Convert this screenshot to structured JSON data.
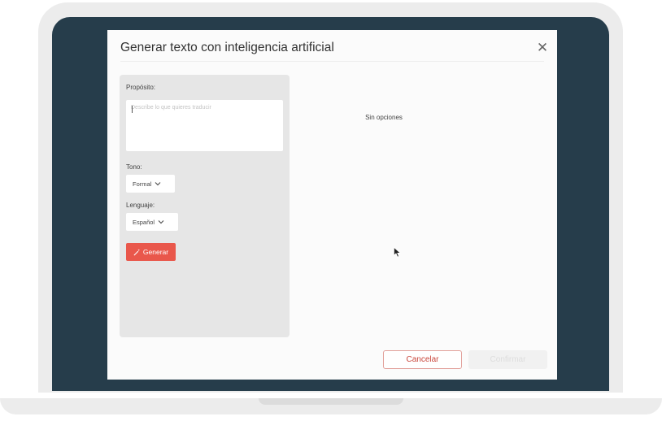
{
  "modal": {
    "title": "Generar texto con inteligencia artificial",
    "close_icon": "close-icon"
  },
  "form": {
    "purpose_label": "Propósito:",
    "purpose_placeholder": "Describe lo que quieres traducir",
    "tone_label": "Tono:",
    "tone_value": "Formal",
    "language_label": "Lenguaje:",
    "language_value": "Español",
    "generate_label": "Generar",
    "generate_icon": "magic-wand-icon"
  },
  "results": {
    "empty_text": "Sin opciones"
  },
  "footer": {
    "cancel_label": "Cancelar",
    "confirm_label": "Confirmar"
  },
  "colors": {
    "screen": "#263d4b",
    "accent": "#e9574b",
    "panel": "#e6e6e6"
  }
}
